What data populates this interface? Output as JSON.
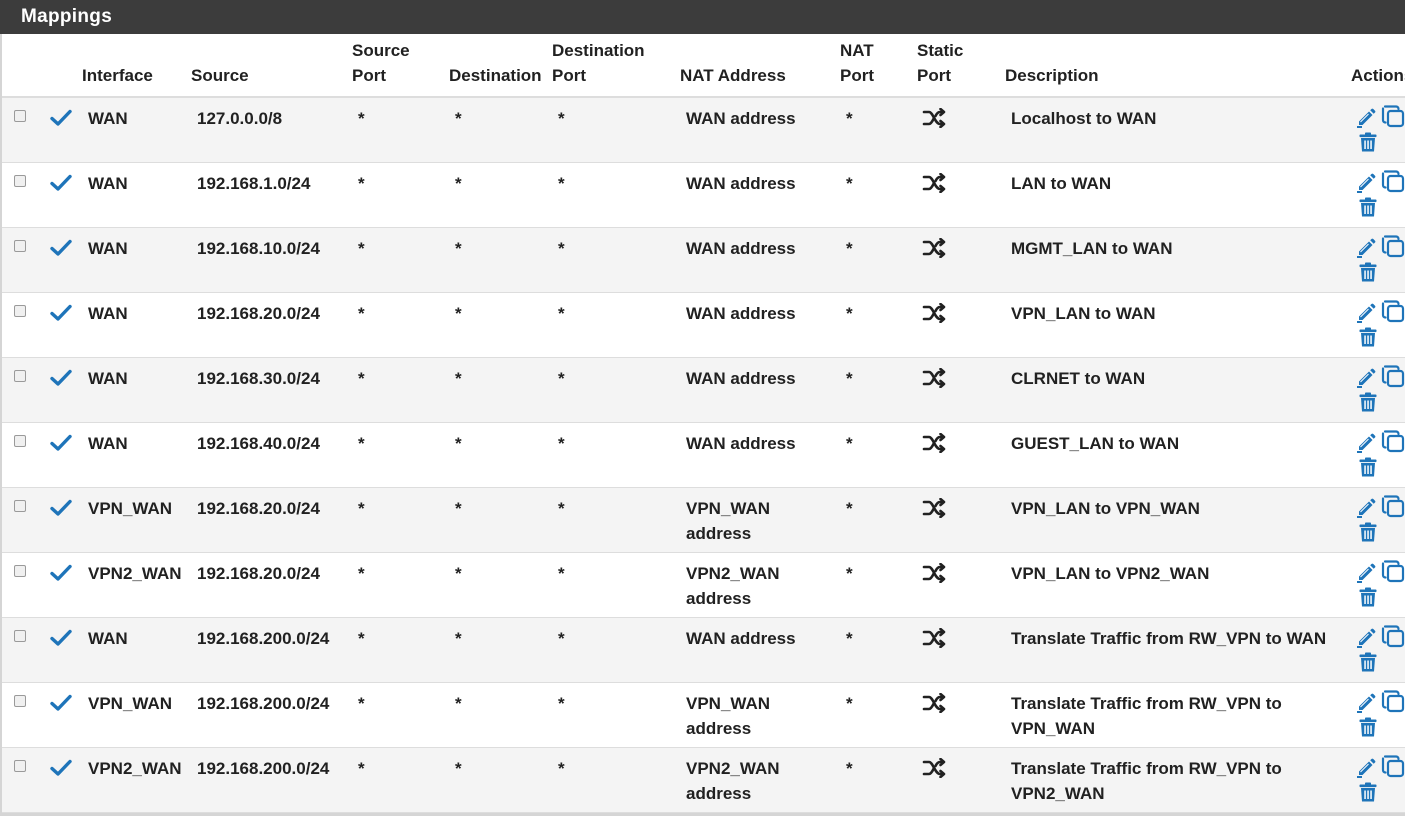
{
  "panel": {
    "title": "Mappings"
  },
  "columns": {
    "interface": "Interface",
    "source": "Source",
    "source_port_1": "Source",
    "source_port_2": "Port",
    "destination": "Destination",
    "destination_port_1": "Destination",
    "destination_port_2": "Port",
    "nat_address": "NAT Address",
    "nat_port_1": "NAT",
    "nat_port_2": "Port",
    "static_port_1": "Static",
    "static_port_2": "Port",
    "description": "Description",
    "actions": "Actions"
  },
  "colors": {
    "header_bg": "#3c3c3c",
    "icon_blue": "#1e74b9",
    "row_alt": "#f4f4f4"
  },
  "icons": {
    "enabled": "check-icon",
    "static_port": "shuffle-icon",
    "edit": "pencil-icon",
    "copy": "copy-icon",
    "delete": "trash-icon"
  },
  "rows": [
    {
      "interface": "WAN",
      "source": "127.0.0.0/8",
      "source_port": "*",
      "destination": "*",
      "destination_port": "*",
      "nat_address": [
        "WAN address"
      ],
      "nat_port": "*",
      "description": [
        "Localhost to WAN"
      ]
    },
    {
      "interface": "WAN",
      "source": "192.168.1.0/24",
      "source_port": "*",
      "destination": "*",
      "destination_port": "*",
      "nat_address": [
        "WAN address"
      ],
      "nat_port": "*",
      "description": [
        "LAN to WAN"
      ]
    },
    {
      "interface": "WAN",
      "source": "192.168.10.0/24",
      "source_port": "*",
      "destination": "*",
      "destination_port": "*",
      "nat_address": [
        "WAN address"
      ],
      "nat_port": "*",
      "description": [
        "MGMT_LAN to WAN"
      ]
    },
    {
      "interface": "WAN",
      "source": "192.168.20.0/24",
      "source_port": "*",
      "destination": "*",
      "destination_port": "*",
      "nat_address": [
        "WAN address"
      ],
      "nat_port": "*",
      "description": [
        "VPN_LAN to WAN"
      ]
    },
    {
      "interface": "WAN",
      "source": "192.168.30.0/24",
      "source_port": "*",
      "destination": "*",
      "destination_port": "*",
      "nat_address": [
        "WAN address"
      ],
      "nat_port": "*",
      "description": [
        "CLRNET to WAN"
      ]
    },
    {
      "interface": "WAN",
      "source": "192.168.40.0/24",
      "source_port": "*",
      "destination": "*",
      "destination_port": "*",
      "nat_address": [
        "WAN address"
      ],
      "nat_port": "*",
      "description": [
        "GUEST_LAN to WAN"
      ]
    },
    {
      "interface": "VPN_WAN",
      "source": "192.168.20.0/24",
      "source_port": "*",
      "destination": "*",
      "destination_port": "*",
      "nat_address": [
        "VPN_WAN",
        "address"
      ],
      "nat_port": "*",
      "description": [
        "VPN_LAN to VPN_WAN"
      ]
    },
    {
      "interface": "VPN2_WAN",
      "source": "192.168.20.0/24",
      "source_port": "*",
      "destination": "*",
      "destination_port": "*",
      "nat_address": [
        "VPN2_WAN",
        "address"
      ],
      "nat_port": "*",
      "description": [
        "VPN_LAN to VPN2_WAN"
      ]
    },
    {
      "interface": "WAN",
      "source": "192.168.200.0/24",
      "source_port": "*",
      "destination": "*",
      "destination_port": "*",
      "nat_address": [
        "WAN address"
      ],
      "nat_port": "*",
      "description": [
        "Translate Traffic from RW_VPN to WAN"
      ]
    },
    {
      "interface": "VPN_WAN",
      "source": "192.168.200.0/24",
      "source_port": "*",
      "destination": "*",
      "destination_port": "*",
      "nat_address": [
        "VPN_WAN",
        "address"
      ],
      "nat_port": "*",
      "description": [
        "Translate Traffic from RW_VPN to",
        "VPN_WAN"
      ]
    },
    {
      "interface": "VPN2_WAN",
      "source": "192.168.200.0/24",
      "source_port": "*",
      "destination": "*",
      "destination_port": "*",
      "nat_address": [
        "VPN2_WAN",
        "address"
      ],
      "nat_port": "*",
      "description": [
        "Translate Traffic from RW_VPN to",
        "VPN2_WAN"
      ]
    }
  ]
}
